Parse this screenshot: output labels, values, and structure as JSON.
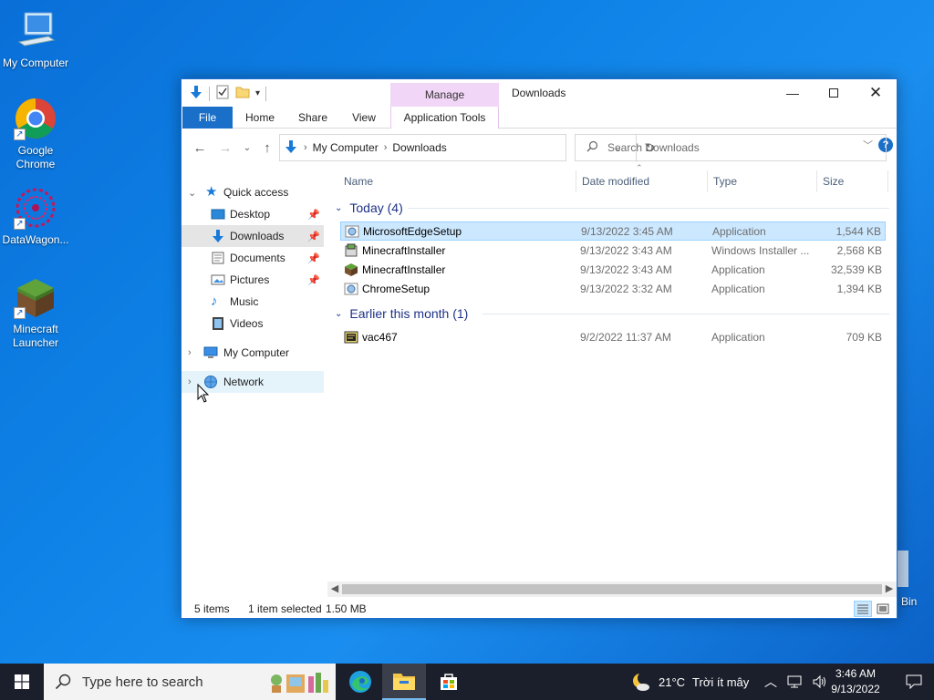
{
  "desktop": {
    "icons": [
      {
        "label": "My Computer"
      },
      {
        "label": "Google Chrome"
      },
      {
        "label": "DataWagon..."
      },
      {
        "label": "Minecraft Launcher"
      }
    ],
    "recycle_bin_label": "Bin"
  },
  "window": {
    "title": "Downloads",
    "manage_tab": "Manage",
    "ribbon_tabs": [
      "File",
      "Home",
      "Share",
      "View",
      "Application Tools"
    ],
    "address": {
      "segments": [
        "My Computer",
        "Downloads"
      ]
    },
    "search": {
      "placeholder": "Search Downloads"
    },
    "nav": {
      "quick_access": "Quick access",
      "items": [
        {
          "label": "Desktop",
          "icon": "desktop-icon",
          "pinned": true
        },
        {
          "label": "Downloads",
          "icon": "downloads-icon",
          "pinned": true
        },
        {
          "label": "Documents",
          "icon": "documents-icon",
          "pinned": true
        },
        {
          "label": "Pictures",
          "icon": "pictures-icon",
          "pinned": true
        },
        {
          "label": "Music",
          "icon": "music-icon",
          "pinned": false
        },
        {
          "label": "Videos",
          "icon": "videos-icon",
          "pinned": false
        }
      ],
      "my_computer": "My Computer",
      "network": "Network"
    },
    "columns": {
      "name": "Name",
      "date": "Date modified",
      "type": "Type",
      "size": "Size"
    },
    "groups": [
      {
        "header": "Today (4)",
        "files": [
          {
            "name": "MicrosoftEdgeSetup",
            "date": "9/13/2022 3:45 AM",
            "type": "Application",
            "size": "1,544 KB",
            "icon": "setup-app-icon",
            "selected": true
          },
          {
            "name": "MinecraftInstaller",
            "date": "9/13/2022 3:43 AM",
            "type": "Windows Installer ...",
            "size": "2,568 KB",
            "icon": "msi-package-icon",
            "selected": false
          },
          {
            "name": "MinecraftInstaller",
            "date": "9/13/2022 3:43 AM",
            "type": "Application",
            "size": "32,539 KB",
            "icon": "minecraft-block-icon",
            "selected": false
          },
          {
            "name": "ChromeSetup",
            "date": "9/13/2022 3:32 AM",
            "type": "Application",
            "size": "1,394 KB",
            "icon": "setup-app-icon",
            "selected": false
          }
        ]
      },
      {
        "header": "Earlier this month (1)",
        "files": [
          {
            "name": "vac467",
            "date": "9/2/2022 11:37 AM",
            "type": "Application",
            "size": "709 KB",
            "icon": "exe-app-icon",
            "selected": false
          }
        ]
      }
    ],
    "status": {
      "count": "5 items",
      "selected": "1 item selected",
      "size": "1.50 MB"
    }
  },
  "taskbar": {
    "search_placeholder": "Type here to search",
    "weather": {
      "temp": "21°C",
      "desc": "Trời ít mây"
    },
    "clock": {
      "time": "3:46 AM",
      "date": "9/13/2022"
    }
  },
  "colors": {
    "accent": "#1a6fc9",
    "selection": "#cce8ff",
    "manage_tab": "#f2d6f7",
    "group_header": "#1e3287"
  }
}
